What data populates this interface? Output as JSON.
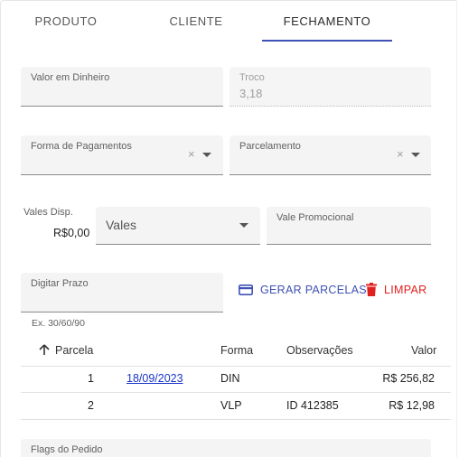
{
  "tabs": [
    {
      "label": "PRODUTO"
    },
    {
      "label": "CLIENTE"
    },
    {
      "label": "FECHAMENTO"
    }
  ],
  "fields": {
    "valor_dinheiro": {
      "label": "Valor em Dinheiro",
      "value": ""
    },
    "troco": {
      "label": "Troco",
      "value": "3,18"
    },
    "forma_pagamento": {
      "label": "Forma de Pagamentos",
      "clear": "×"
    },
    "parcelamento": {
      "label": "Parcelamento",
      "clear": "×"
    },
    "vales_disp": {
      "label": "Vales Disp.",
      "value": "R$0,00"
    },
    "vales": {
      "value": "Vales"
    },
    "vale_promocional": {
      "label": "Vale Promocional"
    },
    "digitar_prazo": {
      "label": "Digitar Prazo",
      "hint": "Ex. 30/60/90"
    },
    "flags_pedido": {
      "label": "Flags do Pedido"
    }
  },
  "actions": {
    "gerar_parcelas": {
      "label": "GERAR PARCELAS",
      "icon": "credit-card-icon",
      "color": "#3f51b5"
    },
    "limpar": {
      "label": "LIMPAR",
      "icon": "trash-icon",
      "color": "#e0201f"
    }
  },
  "table": {
    "sort_icon": "arrow-up-icon",
    "headers": {
      "parcela": "Parcela",
      "forma": "Forma",
      "observacoes": "Observações",
      "valor": "Valor"
    },
    "rows": [
      {
        "parcela": "1",
        "data": "18/09/2023",
        "forma": "DIN",
        "observacoes": "",
        "valor": "R$ 256,82"
      },
      {
        "parcela": "2",
        "data": "",
        "forma": "VLP",
        "observacoes": "ID 412385",
        "valor": "R$ 12,98"
      }
    ]
  },
  "colors": {
    "accent": "#3f51b5",
    "danger": "#e0201f",
    "link": "#1a35c8"
  }
}
